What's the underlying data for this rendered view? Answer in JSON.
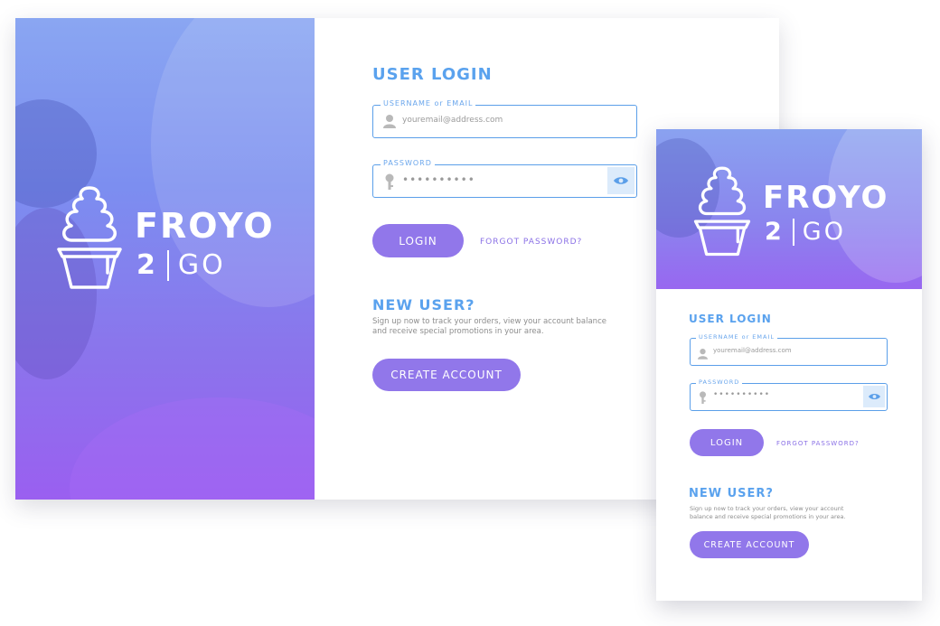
{
  "brand": {
    "word": "FROYO",
    "num": "2",
    "sub": "GO"
  },
  "login": {
    "title": "USER LOGIN",
    "username_label": "USERNAME or EMAIL",
    "username_placeholder": "youremail@address.com",
    "password_label": "PASSWORD",
    "password_mask": "••••••••••",
    "login_button": "LOGIN",
    "forgot_link": "FORGOT PASSWORD?"
  },
  "new_user": {
    "title": "NEW USER?",
    "desc_desktop_line1": "Sign up now to track your orders, view your account balance",
    "desc_desktop_line2": "and receive special promotions in your area.",
    "desc_mobile_line1": "Sign up now to track your orders, view your account",
    "desc_mobile_line2": "balance and receive special promotions in your area.",
    "create_button": "CREATE ACCOUNT"
  },
  "icons": {
    "logo": "froyo-cup-icon",
    "user": "user-icon",
    "key": "key-icon",
    "eye": "eye-icon"
  },
  "colors": {
    "accent_blue": "#5b9fe9",
    "button_purple": "#9177ea",
    "gradient_top": "#8aa6f2",
    "gradient_bottom": "#9a5ff0"
  }
}
